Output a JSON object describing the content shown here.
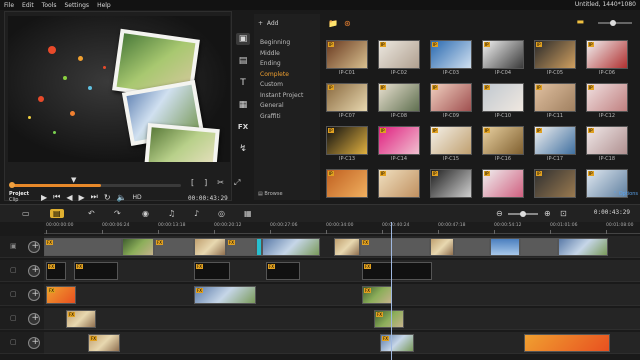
{
  "menu": [
    "File",
    "Edit",
    "Tools",
    "Settings",
    "Help"
  ],
  "window_title": "Untitled, 1440*1080",
  "player": {
    "mode_label": "Project",
    "sub_label": "Clip",
    "timecode": "00:00:43:29",
    "quality": "HD",
    "progress": 0.53,
    "trim_left": "[",
    "trim_right": "]"
  },
  "library": {
    "add_label": "Add",
    "categories": [
      "Beginning",
      "Middle",
      "Ending",
      "Complete",
      "Custom",
      "Instant Project",
      "General",
      "Graffiti"
    ],
    "selected_category": "Complete",
    "browse_label": "Browse",
    "options_label": "Options",
    "side_icons": [
      "media-icon",
      "instant-project-icon",
      "title-icon",
      "transition-icon",
      "fx-icon",
      "path-icon"
    ]
  },
  "thumbnails": [
    {
      "label": "IP-C01",
      "colors": [
        "#6a3a20",
        "#d8c090"
      ]
    },
    {
      "label": "IP-C02",
      "colors": [
        "#ece8e0",
        "#b0a090"
      ]
    },
    {
      "label": "IP-C03",
      "colors": [
        "#2a6ab0",
        "#d0e0f0"
      ]
    },
    {
      "label": "IP-C04",
      "colors": [
        "#f2f2f2",
        "#3a3a3a"
      ]
    },
    {
      "label": "IP-C05",
      "colors": [
        "#2a2a2a",
        "#d0a060"
      ]
    },
    {
      "label": "IP-C06",
      "colors": [
        "#f0f0f0",
        "#b03030"
      ]
    },
    {
      "label": "IP-C07",
      "colors": [
        "#8a6a40",
        "#e8d8b0"
      ]
    },
    {
      "label": "IP-C08",
      "colors": [
        "#e8e0d0",
        "#607050"
      ]
    },
    {
      "label": "IP-C09",
      "colors": [
        "#f0d0c0",
        "#a05050"
      ]
    },
    {
      "label": "IP-C10",
      "colors": [
        "#c0c8d0",
        "#f0e8e0"
      ]
    },
    {
      "label": "IP-C11",
      "colors": [
        "#e0c0a0",
        "#a08060"
      ]
    },
    {
      "label": "IP-C12",
      "colors": [
        "#f0e0e0",
        "#c08080"
      ]
    },
    {
      "label": "IP-C13",
      "colors": [
        "#101010",
        "#e0b040"
      ]
    },
    {
      "label": "IP-C14",
      "colors": [
        "#e02080",
        "#f0c0d0"
      ]
    },
    {
      "label": "IP-C15",
      "colors": [
        "#f4f0e8",
        "#c0a070"
      ]
    },
    {
      "label": "IP-C16",
      "colors": [
        "#e8d0a0",
        "#806030"
      ]
    },
    {
      "label": "IP-C17",
      "colors": [
        "#f0f0f0",
        "#4070a0"
      ]
    },
    {
      "label": "IP-C18",
      "colors": [
        "#f0e8e8",
        "#b09090"
      ]
    },
    {
      "label": "",
      "colors": [
        "#c06020",
        "#f0b060"
      ]
    },
    {
      "label": "",
      "colors": [
        "#f0e0c0",
        "#c09060"
      ]
    },
    {
      "label": "",
      "colors": [
        "#202020",
        "#d0d0d0"
      ]
    },
    {
      "label": "",
      "colors": [
        "#f0f0f0",
        "#d06080"
      ]
    },
    {
      "label": "",
      "colors": [
        "#303030",
        "#9a7a50"
      ]
    },
    {
      "label": "",
      "colors": [
        "#e0e8f0",
        "#6080a0"
      ]
    }
  ],
  "timeline": {
    "current_time": "0:00:43:29",
    "ruler_ticks": [
      "00:00:00:00",
      "00:00:06:24",
      "00:00:13:18",
      "00:00:20:12",
      "00:00:27:06",
      "00:00:34:00",
      "00:00:40:24",
      "00:00:47:18",
      "00:00:54:12",
      "00:01:01:06",
      "00:01:08:00"
    ],
    "toolbar": [
      "storyboard-view-icon",
      "timeline-view-icon",
      "undo-icon",
      "redo-icon",
      "record-capture-icon",
      "sound-mixer-icon",
      "auto-music-icon",
      "motion-tracking-icon",
      "subtitle-icon"
    ]
  },
  "colors": {
    "accent": "#f0a030",
    "playhead": "#9fb8e0",
    "tag": "#e0a020"
  }
}
